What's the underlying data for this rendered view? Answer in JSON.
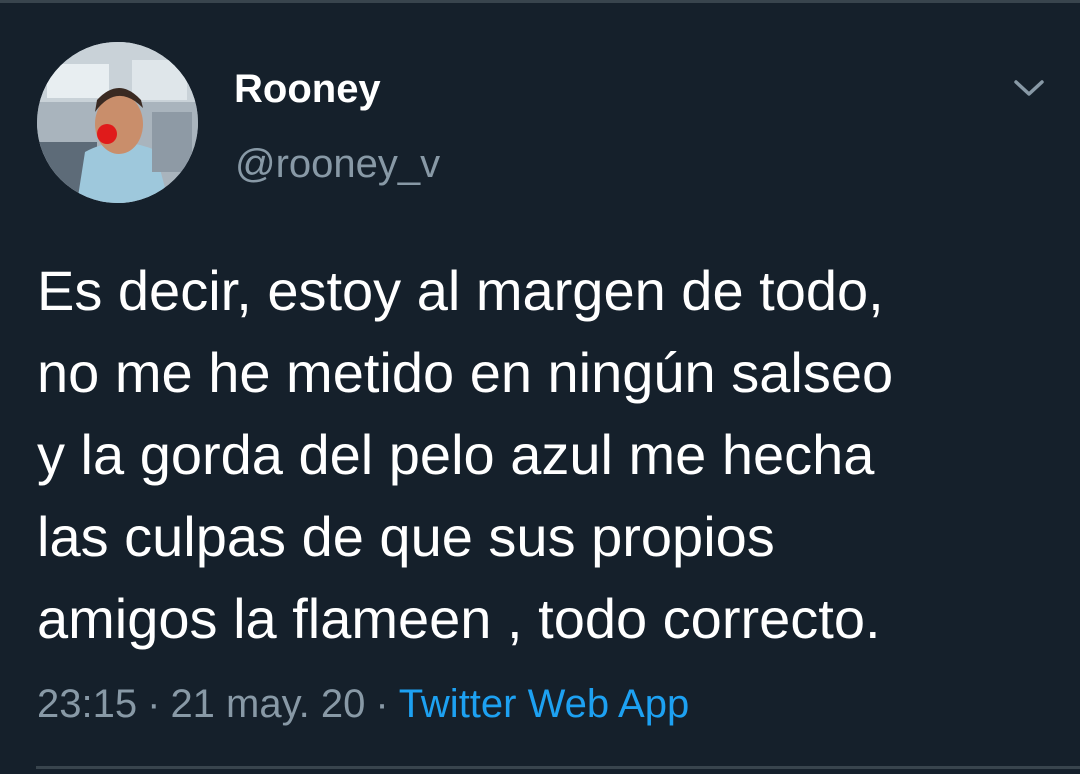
{
  "tweet": {
    "author": {
      "display_name": "Rooney",
      "username": "@rooney_v"
    },
    "text_lines": [
      "Es decir, estoy al margen de todo,",
      "no me he metido en ningún salseo",
      "y la gorda del pelo azul me hecha",
      "las culpas de que sus propios",
      "amigos la flameen , todo correcto."
    ],
    "time": "23:15",
    "date": "21 may. 20",
    "separator": "·",
    "source": "Twitter Web App"
  },
  "icons": {
    "more": "chevron-down-icon"
  },
  "colors": {
    "background": "#15202b",
    "primary_text": "#ffffff",
    "secondary_text": "#8899a6",
    "link": "#1da1f2",
    "divider": "#38444d"
  }
}
